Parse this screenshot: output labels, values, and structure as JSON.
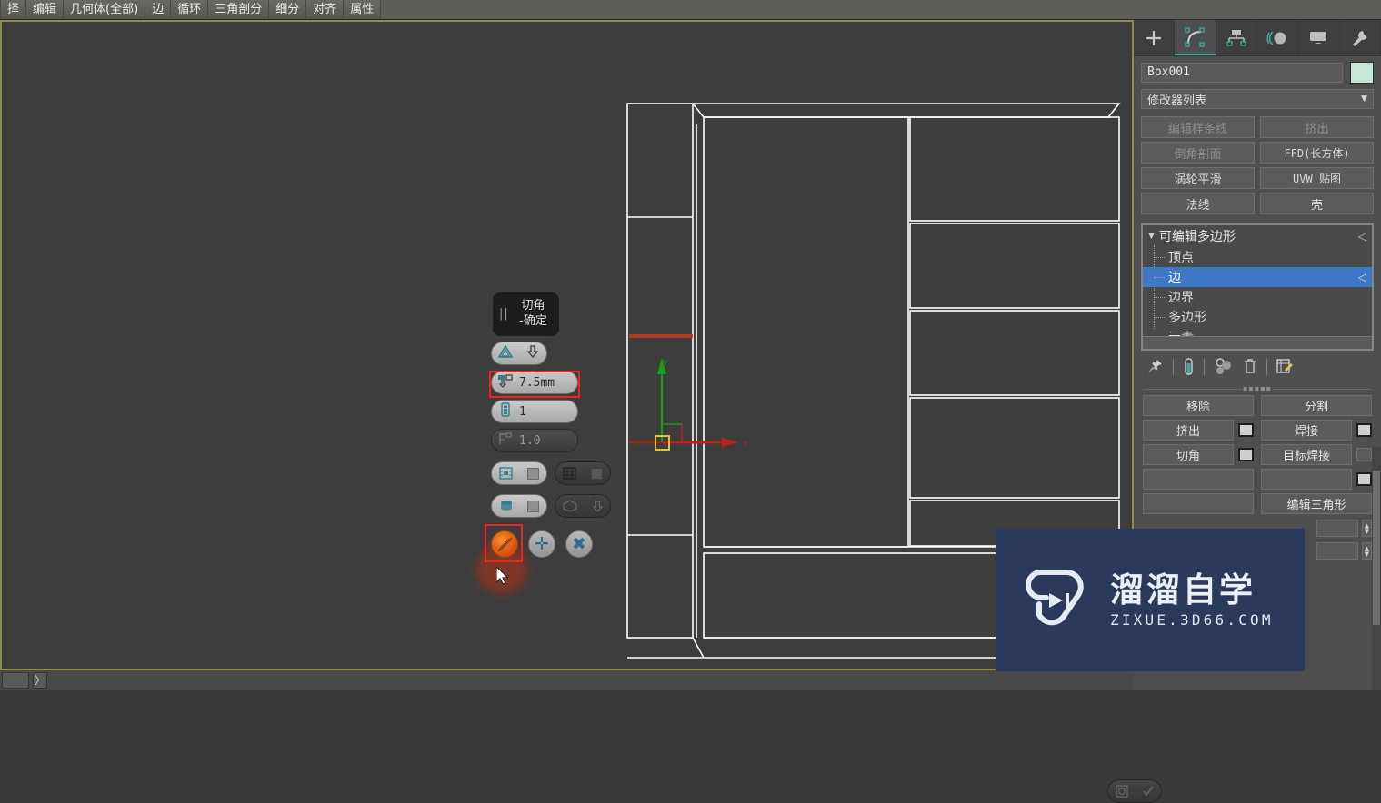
{
  "menubar": {
    "items": [
      {
        "label": "择"
      },
      {
        "label": "编辑"
      },
      {
        "label": "几何体(全部)"
      },
      {
        "label": "边"
      },
      {
        "label": "循环"
      },
      {
        "label": "三角剖分"
      },
      {
        "label": "细分"
      },
      {
        "label": "对齐"
      },
      {
        "label": "属性"
      }
    ]
  },
  "viewport": {
    "gizmo": {
      "x_label": "x",
      "y_label": "y"
    },
    "background_color": "#3d3d3d",
    "edge_color": "#ffffff",
    "selected_edge_color": "#b53a21",
    "active_border_color": "#918a4e"
  },
  "caddy": {
    "title_line1": "切角",
    "title_line2": "-确定",
    "pause_glyph": "||",
    "toggle_icons": {
      "type": "triangle-icon",
      "apply_down": "arrow-down-icon"
    },
    "amount": {
      "icon": "chamfer-amount-icon",
      "value": "7.5mm"
    },
    "segments": {
      "icon": "segments-icon",
      "value": "1"
    },
    "tension": {
      "icon": "tension-icon",
      "value": "1.0"
    },
    "toggles": [
      {
        "icon": "open-chamfer-icon",
        "state": "on"
      },
      {
        "icon": "quad-chamfer-icon",
        "state": "off"
      },
      {
        "icon": "invert-open-icon",
        "state": "off"
      },
      {
        "icon": "smooth-icon",
        "state": "on"
      },
      {
        "icon": "smooth-threshold-icon",
        "state": "off"
      }
    ],
    "actions": {
      "apply_ok": "apply-and-continue-icon",
      "ok": "ok-plus-icon",
      "cancel": "cancel-x-icon"
    },
    "highlight_color": "#f02323"
  },
  "command_panel": {
    "tabs": [
      {
        "name": "create-tab",
        "icon": "plus-icon",
        "active": false
      },
      {
        "name": "modify-tab",
        "icon": "modify-bend-icon",
        "active": true
      },
      {
        "name": "hierarchy-tab",
        "icon": "hierarchy-icon",
        "active": false
      },
      {
        "name": "motion-tab",
        "icon": "motion-icon",
        "active": false
      },
      {
        "name": "display-tab",
        "icon": "display-monitor-icon",
        "active": false
      },
      {
        "name": "utilities-tab",
        "icon": "wrench-icon",
        "active": false
      }
    ],
    "object_name": "Box001",
    "object_color": "#c8e6d5",
    "modifier_list_label": "修改器列表",
    "modifier_buttons": [
      {
        "label": "编辑样条线",
        "dim": true,
        "mono": false
      },
      {
        "label": "挤出",
        "dim": true,
        "mono": false
      },
      {
        "label": "倒角剖面",
        "dim": true,
        "mono": false
      },
      {
        "label": "FFD(长方体)",
        "dim": false,
        "mono": true
      },
      {
        "label": "涡轮平滑",
        "dim": false,
        "mono": false
      },
      {
        "label": "UVW 贴图",
        "dim": false,
        "mono": true
      },
      {
        "label": "法线",
        "dim": false,
        "mono": false
      },
      {
        "label": "壳",
        "dim": false,
        "mono": false
      }
    ],
    "modifier_stack": {
      "root": "可编辑多边形",
      "sub_objects": [
        {
          "label": "顶点",
          "selected": false
        },
        {
          "label": "边",
          "selected": true
        },
        {
          "label": "边界",
          "selected": false
        },
        {
          "label": "多边形",
          "selected": false
        },
        {
          "label": "元素",
          "selected": false
        }
      ],
      "selection_color": "#3e79c8"
    },
    "stack_tools": [
      {
        "name": "pin-stack-icon"
      },
      {
        "name": "show-end-result-icon"
      },
      {
        "name": "make-unique-icon"
      },
      {
        "name": "remove-modifier-icon"
      },
      {
        "name": "configure-sets-icon"
      }
    ],
    "edit_edges": {
      "rows": [
        [
          {
            "label": "移除",
            "settings": false
          },
          {
            "label": "分割",
            "settings": false
          }
        ],
        [
          {
            "label": "挤出",
            "settings": true
          },
          {
            "label": "焊接",
            "settings": true
          }
        ],
        [
          {
            "label": "切角",
            "settings": true
          },
          {
            "label": "目标焊接",
            "settings": false
          }
        ],
        [
          {
            "label": "",
            "settings": false
          },
          {
            "label": "",
            "settings": true
          }
        ],
        [
          {
            "label": "",
            "settings": false
          },
          {
            "label": "编辑三角形",
            "settings": false
          }
        ]
      ]
    }
  },
  "bottom_bar": {
    "expand_glyph": "〉"
  },
  "watermark": {
    "brand_cn": "溜溜自学",
    "brand_en": "ZIXUE.3D66.COM",
    "background": "#2b3a5c",
    "logo": "play-triangle-logo"
  }
}
